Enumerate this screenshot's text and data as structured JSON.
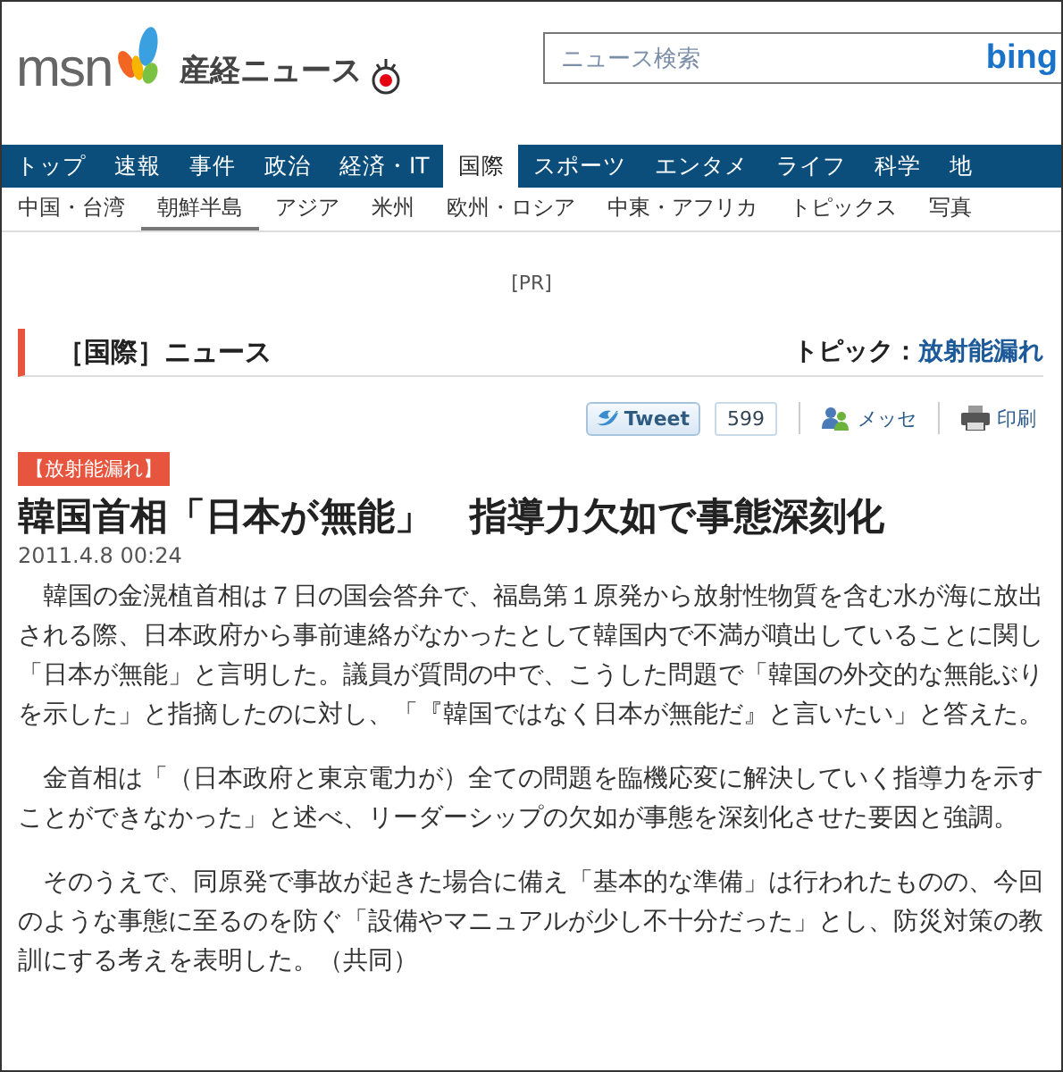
{
  "header": {
    "logo": "msn",
    "brand": "産経ニュース",
    "search": {
      "placeholder": "ニュース検索",
      "engine": "bing"
    }
  },
  "nav": [
    {
      "label": "トップ",
      "selected": false
    },
    {
      "label": "速報",
      "selected": false
    },
    {
      "label": "事件",
      "selected": false
    },
    {
      "label": "政治",
      "selected": false
    },
    {
      "label": "経済・IT",
      "selected": false
    },
    {
      "label": "国際",
      "selected": true
    },
    {
      "label": "スポーツ",
      "selected": false
    },
    {
      "label": "エンタメ",
      "selected": false
    },
    {
      "label": "ライフ",
      "selected": false
    },
    {
      "label": "科学",
      "selected": false
    },
    {
      "label": "地",
      "selected": false
    }
  ],
  "subnav": [
    {
      "label": "中国・台湾",
      "selected": false
    },
    {
      "label": "朝鮮半島",
      "selected": true
    },
    {
      "label": "アジア",
      "selected": false
    },
    {
      "label": "米州",
      "selected": false
    },
    {
      "label": "欧州・ロシア",
      "selected": false
    },
    {
      "label": "中東・アフリカ",
      "selected": false
    },
    {
      "label": "トピックス",
      "selected": false
    },
    {
      "label": "写真",
      "selected": false
    }
  ],
  "pr": "[PR]",
  "section": {
    "title": "［国際］ニュース",
    "topic_label": "トピック：",
    "topic": "放射能漏れ"
  },
  "share": {
    "tweet": "Tweet",
    "count": "599",
    "message": "メッセ",
    "print": "印刷"
  },
  "article": {
    "tag": "【放射能漏れ】",
    "headline": "韓国首相「日本が無能」　指導力欠如で事態深刻化",
    "date": "2011.4.8 00:24",
    "paragraphs": [
      "韓国の金滉植首相は７日の国会答弁で、福島第１原発から放射性物質を含む水が海に放出される際、日本政府から事前連絡がなかったとして韓国内で不満が噴出していることに関し「日本が無能」と言明した。議員が質問の中で、こうした問題で「韓国の外交的な無能ぶりを示した」と指摘したのに対し、「『韓国ではなく日本が無能だ』と言いたい」と答えた。",
      "金首相は「（日本政府と東京電力が）全ての問題を臨機応変に解決していく指導力を示すことができなかった」と述べ、リーダーシップの欠如が事態を深刻化させた要因と強調。",
      "そのうえで、同原発で事故が起きた場合に備え「基本的な準備」は行われたものの、今回のような事態に至るのを防ぐ「設備やマニュアルが少し不十分だった」とし、防災対策の教訓にする考えを表明した。（共同）"
    ]
  }
}
